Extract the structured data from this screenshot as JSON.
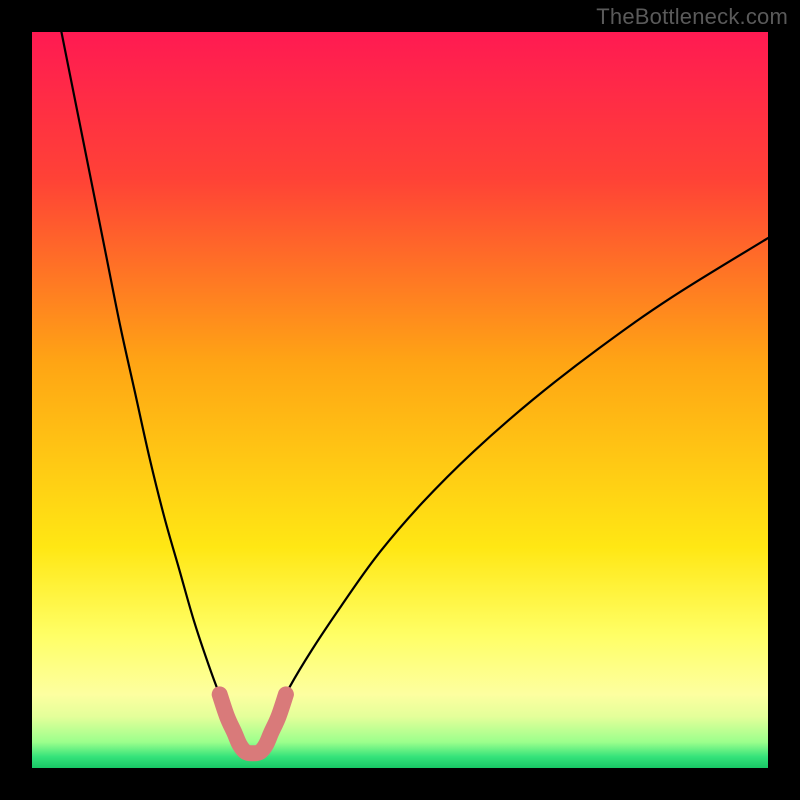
{
  "watermark": "TheBottleneck.com",
  "chart_data": {
    "type": "line",
    "title": "",
    "xlabel": "",
    "ylabel": "",
    "xlim": [
      0,
      100
    ],
    "ylim": [
      0,
      100
    ],
    "grid": false,
    "legend": false,
    "background_gradient_stops": [
      {
        "offset": 0.0,
        "color": "#ff1a52"
      },
      {
        "offset": 0.2,
        "color": "#ff4236"
      },
      {
        "offset": 0.45,
        "color": "#ffa514"
      },
      {
        "offset": 0.7,
        "color": "#ffe714"
      },
      {
        "offset": 0.82,
        "color": "#ffff66"
      },
      {
        "offset": 0.9,
        "color": "#fdffa0"
      },
      {
        "offset": 0.93,
        "color": "#e4ff9a"
      },
      {
        "offset": 0.965,
        "color": "#9bff8c"
      },
      {
        "offset": 0.985,
        "color": "#34e27a"
      },
      {
        "offset": 1.0,
        "color": "#18c765"
      }
    ],
    "minimum_x": 30,
    "series": [
      {
        "name": "left-branch",
        "style": "thin-black",
        "x": [
          4,
          6,
          8,
          10,
          12,
          14,
          16,
          18,
          20,
          22,
          24,
          25.5,
          27,
          28.5
        ],
        "y": [
          100,
          90,
          80,
          70,
          60,
          51,
          42,
          34,
          27,
          20,
          14,
          10,
          7,
          4.5
        ]
      },
      {
        "name": "right-branch",
        "style": "thin-black",
        "x": [
          31.5,
          33,
          35,
          38,
          42,
          47,
          53,
          60,
          68,
          77,
          87,
          100
        ],
        "y": [
          4.5,
          7,
          11,
          16,
          22,
          29,
          36,
          43,
          50,
          57,
          64,
          72
        ]
      },
      {
        "name": "valley-highlight",
        "style": "thick-salmon",
        "x": [
          25.5,
          26.5,
          27.5,
          28.2,
          29,
          30,
          31,
          31.8,
          32.5,
          33.5,
          34.5
        ],
        "y": [
          10,
          7,
          4.8,
          3.2,
          2.2,
          2.0,
          2.2,
          3.2,
          4.8,
          7,
          10
        ]
      }
    ],
    "styles": {
      "thin-black": {
        "stroke": "#000000",
        "width": 2.2,
        "linecap": "round"
      },
      "thick-salmon": {
        "stroke": "#d97a7a",
        "width": 16,
        "linecap": "round"
      }
    }
  }
}
